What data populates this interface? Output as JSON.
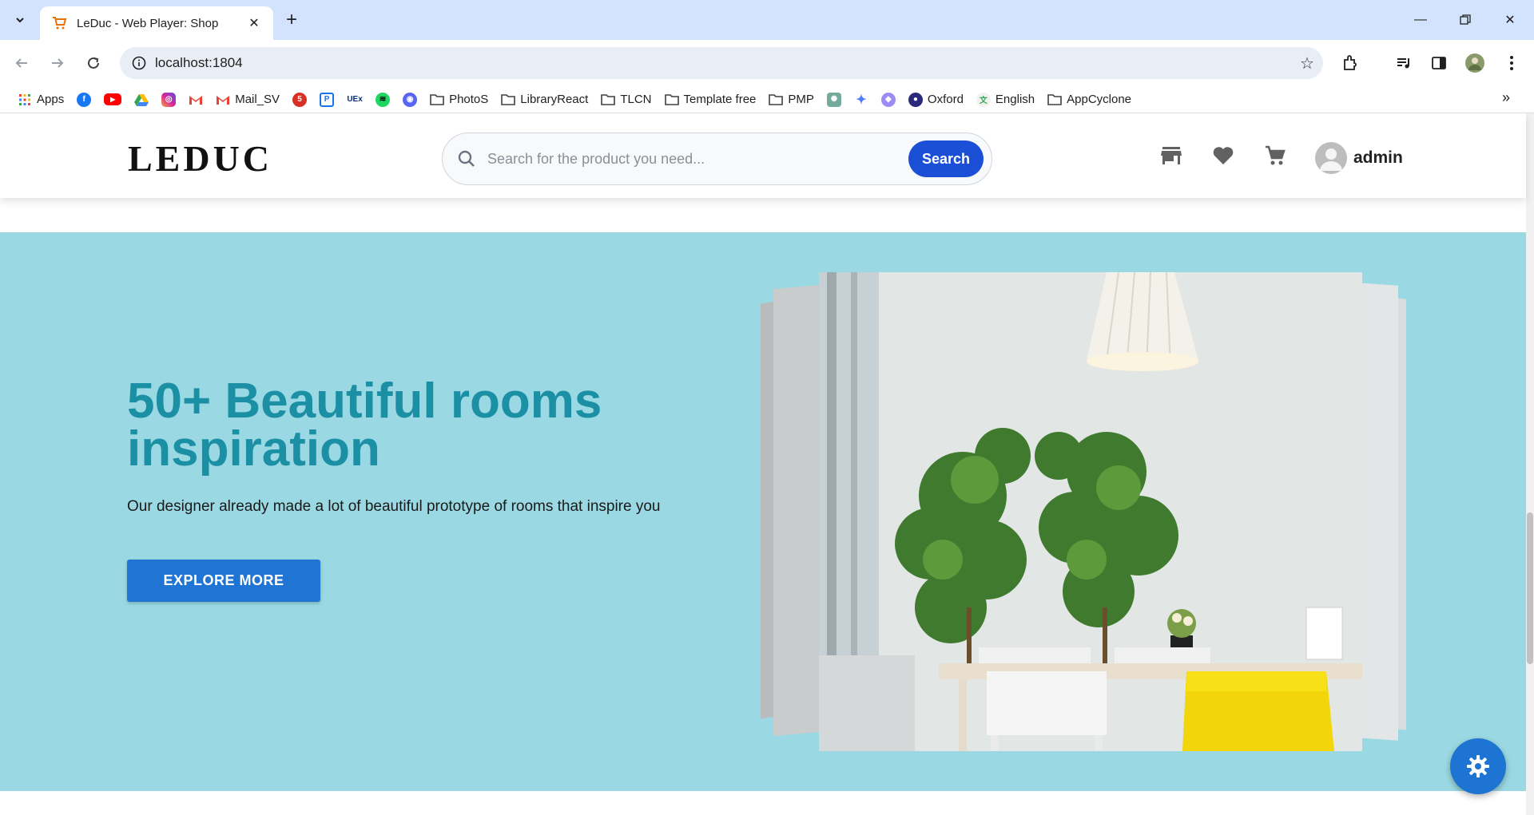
{
  "browser": {
    "tab_title": "LeDuc - Web Player: Shop",
    "url": "localhost:1804",
    "bookmarks": [
      {
        "label": "Apps",
        "icon": "apps-grid-icon"
      },
      {
        "label": "",
        "icon": "facebook-icon"
      },
      {
        "label": "",
        "icon": "youtube-icon"
      },
      {
        "label": "",
        "icon": "google-drive-icon"
      },
      {
        "label": "",
        "icon": "instagram-icon"
      },
      {
        "label": "",
        "icon": "gmail-icon"
      },
      {
        "label": "Mail_SV",
        "icon": "gmail-icon"
      },
      {
        "label": "",
        "icon": "badge-app-icon"
      },
      {
        "label": "",
        "icon": "ps-app-icon"
      },
      {
        "label": "",
        "icon": "uex-icon"
      },
      {
        "label": "",
        "icon": "spotify-icon"
      },
      {
        "label": "",
        "icon": "discord-icon"
      },
      {
        "label": "PhotoS",
        "icon": "folder-icon"
      },
      {
        "label": "LibraryReact",
        "icon": "folder-icon"
      },
      {
        "label": "TLCN",
        "icon": "folder-icon"
      },
      {
        "label": "Template free",
        "icon": "folder-icon"
      },
      {
        "label": "PMP",
        "icon": "folder-icon"
      },
      {
        "label": "",
        "icon": "chatgpt-icon"
      },
      {
        "label": "",
        "icon": "gemini-icon"
      },
      {
        "label": "",
        "icon": "shield-app-icon"
      },
      {
        "label": "Oxford",
        "icon": "oxford-icon"
      },
      {
        "label": "English",
        "icon": "translate-icon"
      },
      {
        "label": "AppCyclone",
        "icon": "folder-icon"
      }
    ]
  },
  "site": {
    "logo": "LEDUC",
    "search": {
      "placeholder": "Search for the product you need...",
      "button": "Search"
    },
    "user": {
      "name": "admin"
    }
  },
  "hero": {
    "title": "50+ Beautiful rooms inspiration",
    "subtitle": "Our designer already made a lot of beautiful prototype of rooms that inspire you",
    "button": "EXPLORE MORE"
  },
  "colors": {
    "hero_bg": "#9ad9e3",
    "hero_title": "#1b8fa3",
    "primary_button": "#1f74d4",
    "search_button": "#1a4fd6"
  }
}
